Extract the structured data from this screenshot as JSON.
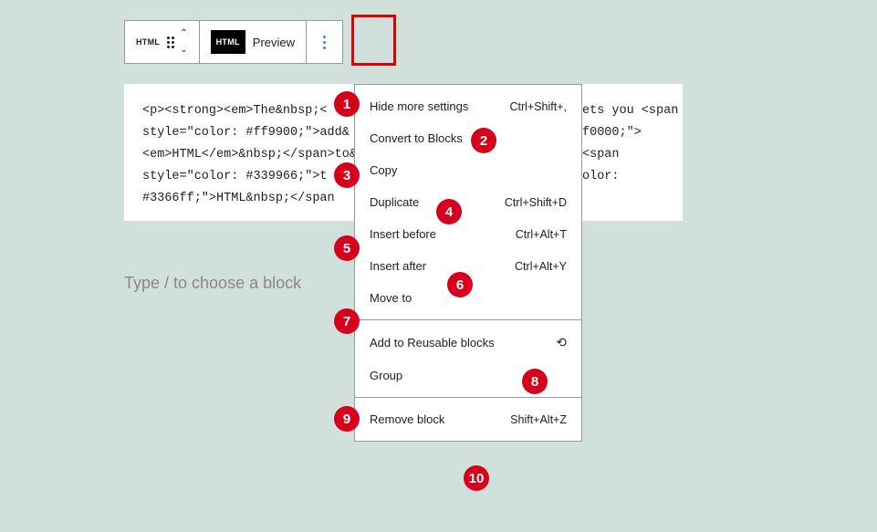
{
  "toolbar": {
    "block_type_label": "HTML",
    "html_mode_label": "HTML",
    "preview_label": "Preview"
  },
  "content_block": {
    "left_lines": [
      "<p><strong><em>The&nbsp;<",
      "style=\"color: #ff9900;\">add&",
      "<em>HTML</em>&nbsp;</span>to&",
      "style=\"color: #339966;\">t",
      "#3366ff;\">HTML&nbsp;</span"
    ],
    "right_lines": [
      "ets you <span",
      "f0000;\">",
      "<span",
      "olor:",
      ""
    ]
  },
  "placeholder_text": "Type / to choose a block",
  "menu": {
    "hide_more": {
      "label": "Hide more settings",
      "shortcut": "Ctrl+Shift+,"
    },
    "convert": {
      "label": "Convert to Blocks",
      "shortcut": ""
    },
    "copy": {
      "label": "Copy",
      "shortcut": ""
    },
    "duplicate": {
      "label": "Duplicate",
      "shortcut": "Ctrl+Shift+D"
    },
    "insert_before": {
      "label": "Insert before",
      "shortcut": "Ctrl+Alt+T"
    },
    "insert_after": {
      "label": "Insert after",
      "shortcut": "Ctrl+Alt+Y"
    },
    "move_to": {
      "label": "Move to",
      "shortcut": ""
    },
    "reusable": {
      "label": "Add to Reusable blocks",
      "shortcut": ""
    },
    "group": {
      "label": "Group",
      "shortcut": ""
    },
    "remove": {
      "label": "Remove block",
      "shortcut": "Shift+Alt+Z"
    }
  },
  "annotations": {
    "n1": "1",
    "n2": "2",
    "n3": "3",
    "n4": "4",
    "n5": "5",
    "n6": "6",
    "n7": "7",
    "n8": "8",
    "n9": "9",
    "n10": "10"
  }
}
